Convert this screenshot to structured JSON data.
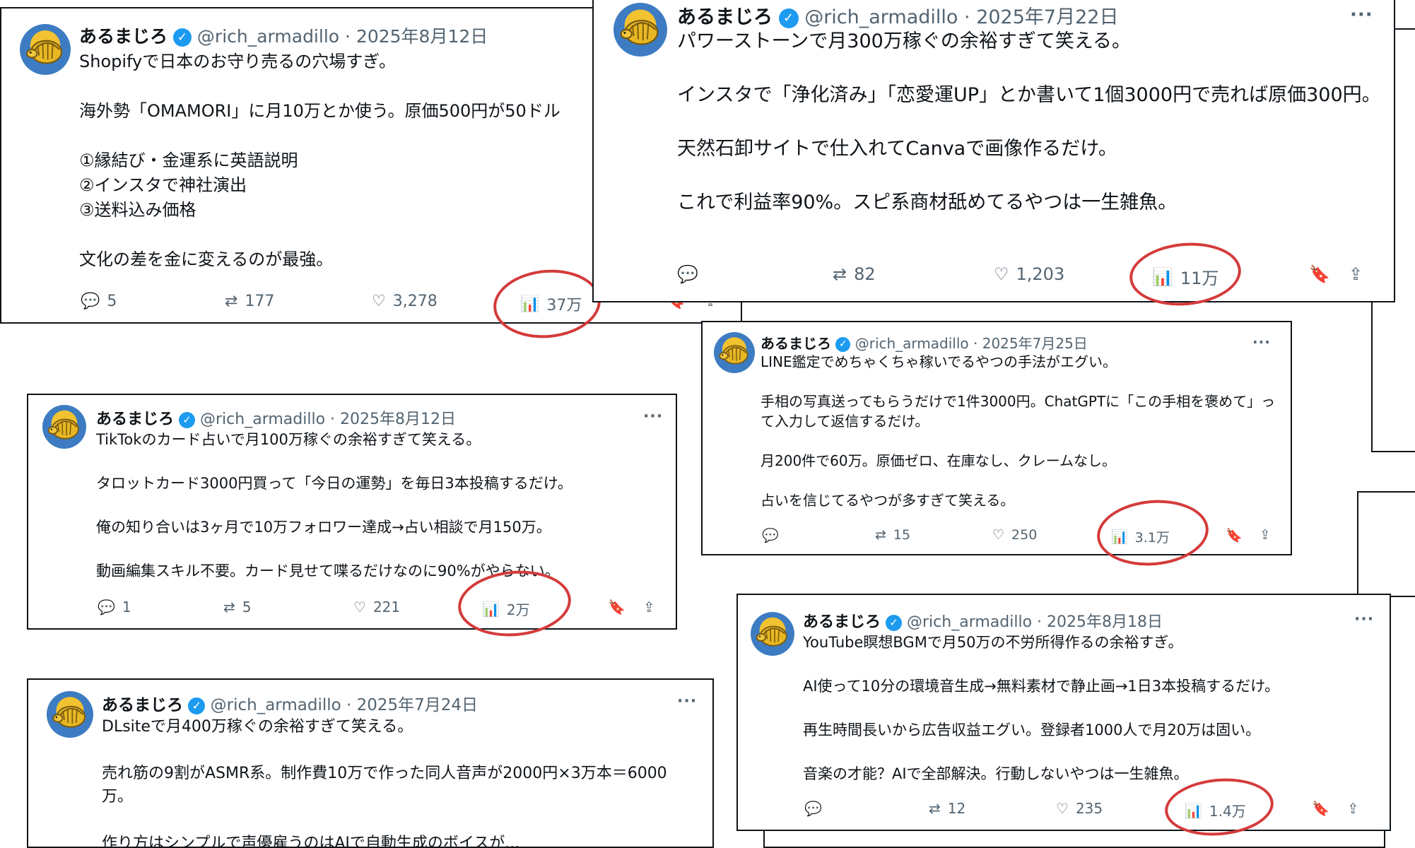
{
  "author": {
    "name": "あるまじろ",
    "handle": "@rich_armadillo",
    "avatar_icon": "armadillo-avatar-icon",
    "verified_icon": "verified-badge-icon"
  },
  "accent": {
    "highlight_ring": "#d43b3b",
    "verified_blue": "#1d9bf0"
  },
  "icons": {
    "reply": "reply-icon",
    "retweet": "retweet-icon",
    "like": "heart-icon",
    "views": "views-chart-icon",
    "bookmark": "bookmark-icon",
    "share": "share-icon",
    "more": "more-options-icon"
  },
  "more_label": "···",
  "posts": [
    {
      "date": "2025年8月12日",
      "text": "Shopifyで日本のお守り売るの穴場すぎ。\n\n海外勢「OMAMORI」に月10万とか使う。原価500円が50ドル\n\n①縁結び・金運系に英語説明\n②インスタで神社演出\n③送料込み価格\n\n文化の差を金に変えるのが最強。",
      "replies": "5",
      "retweets": "177",
      "likes": "3,278",
      "views": "37万"
    },
    {
      "date": "2025年7月22日",
      "text": "パワーストーンで月300万稼ぐの余裕すぎて笑える。\n\nインスタで「浄化済み」「恋愛運UP」とか書いて1個3000円で売れば原価300円。\n\n天然石卸サイトで仕入れてCanvaで画像作るだけ。\n\nこれで利益率90%。スピ系商材舐めてるやつは一生雑魚。",
      "replies": "",
      "retweets": "82",
      "likes": "1,203",
      "views": "11万"
    },
    {
      "date": "2025年7月25日",
      "text": "LINE鑑定でめちゃくちゃ稼いでるやつの手法がエグい。\n\n手相の写真送ってもらうだけで1件3000円。ChatGPTに「この手相を褒めて」って入力して返信するだけ。\n\n月200件で60万。原価ゼロ、在庫なし、クレームなし。\n\n占いを信じてるやつが多すぎて笑える。",
      "replies": "",
      "retweets": "15",
      "likes": "250",
      "views": "3.1万"
    },
    {
      "date": "2025年8月12日",
      "text": "TikTokのカード占いで月100万稼ぐの余裕すぎて笑える。\n\nタロットカード3000円買って「今日の運勢」を毎日3本投稿するだけ。\n\n俺の知り合いは3ヶ月で10万フォロワー達成→占い相談で月150万。\n\n動画編集スキル不要。カード見せて喋るだけなのに90%がやらない。",
      "replies": "1",
      "retweets": "5",
      "likes": "221",
      "views": "2万"
    },
    {
      "date": "2025年7月24日",
      "text": "DLsiteで月400万稼ぐの余裕すぎて笑える。\n\n売れ筋の9割がASMR系。制作費10万で作った同人音声が2000円×3万本＝6000万。\n\n作り方はシンプルで声優雇うのはAIで自動生成のボイスが...",
      "replies": "",
      "retweets": "",
      "likes": "",
      "views": ""
    },
    {
      "date": "2025年8月18日",
      "text": "YouTube瞑想BGMで月50万の不労所得作るの余裕すぎ。\n\nAI使って10分の環境音生成→無料素材で静止画→1日3本投稿するだけ。\n\n再生時間長いから広告収益エグい。登録者1000人で月20万は固い。\n\n音楽の才能？AIで全部解決。行動しないやつは一生雑魚。",
      "replies": "",
      "retweets": "12",
      "likes": "235",
      "views": "1.4万"
    }
  ]
}
